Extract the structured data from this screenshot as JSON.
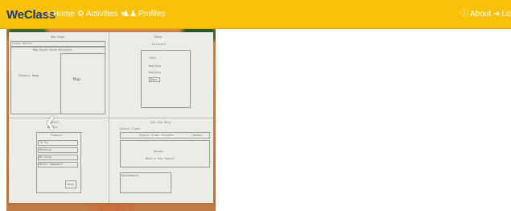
{
  "navbar": {
    "brand": "WeClass",
    "home": "Home",
    "activities": "Activities",
    "profiles": "Profiles",
    "about": "About",
    "login": "Log"
  },
  "sketch": {
    "panel1": {
      "title": "Map Page",
      "bar": "Class  Select",
      "tabs": "Map  Route  Area  Distance",
      "left": "Student Room",
      "right": "Map"
    },
    "panel2": {
      "title": "Tasks",
      "sub": "Activity",
      "l1": "Task",
      "l2": "Routine",
      "l3": "Routine",
      "btn": "Done"
    },
    "panel3": {
      "title": "Planner",
      "sub": "Weekly",
      "head": "Planner",
      "r1": "To Do",
      "r2": "Reading",
      "r3": "Writing",
      "r4": "Maths  Homework",
      "btn": "Save"
    },
    "panel4": {
      "title": "Ask and Help",
      "bar": "Search  Class",
      "tabs": "Public  Class  Private",
      "corner": "Submit",
      "q1": "Answer",
      "q2": "What's the topic?",
      "note": "Whiteboard"
    }
  }
}
